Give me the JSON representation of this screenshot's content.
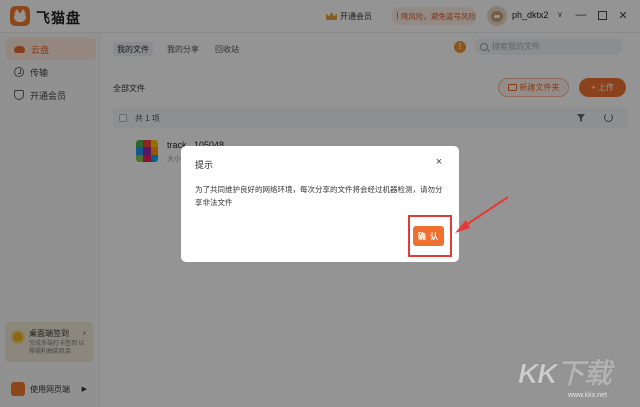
{
  "app": {
    "name": "飞猫盘"
  },
  "titlebar": {
    "vip_label": "开通会员",
    "security_notice": "降风险，避免盗号风险",
    "username": "ph_dktx2",
    "caret": "∨",
    "minimize": "—",
    "close": "✕"
  },
  "sidebar": {
    "items": [
      {
        "label": "云盘",
        "icon": "cloud-icon",
        "active": true
      },
      {
        "label": "传输",
        "icon": "transfer-icon",
        "active": false
      },
      {
        "label": "开通会员",
        "icon": "shield-icon",
        "active": false
      }
    ],
    "checkin": {
      "title": "桌面端签到",
      "arrow": "›",
      "subtitle": "完成多端打卡签到 以得福利抽奖机会"
    },
    "web_label": "使用网页端",
    "web_arrow": "▶"
  },
  "main": {
    "tabs": [
      "我的文件",
      "我的分享",
      "回收站"
    ],
    "info_icon": "!",
    "search_placeholder": "搜索我的文件",
    "section_title": "全部文件",
    "new_folder_label": "新建文件夹",
    "upload_label": "+ 上传",
    "count_label": "共 1 项",
    "file": {
      "name": "track...105048",
      "meta": "大小..."
    }
  },
  "dialog": {
    "title": "提示",
    "close": "×",
    "body": "为了共同维护良好的网络环境，每次分享的文件将会经过机器检测，请勿分享非法文件",
    "confirm_label": "确 认"
  },
  "colors": {
    "accent": "#ef7031",
    "annotation": "#e53935"
  },
  "watermark": {
    "logo": "KK下载",
    "url": "www.kkx.net"
  }
}
